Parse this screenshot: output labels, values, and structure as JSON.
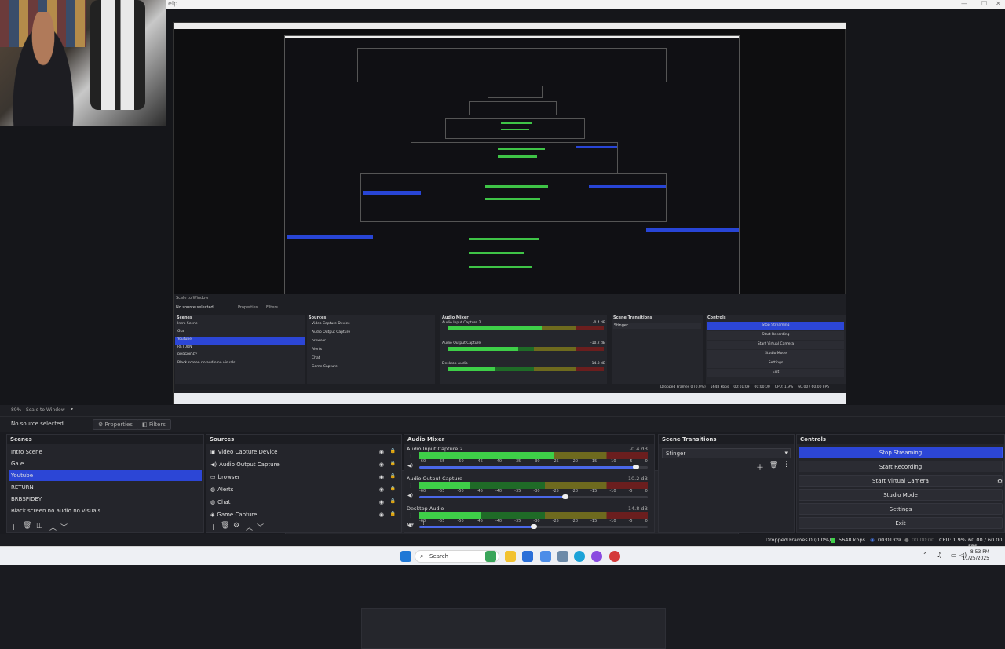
{
  "window": {
    "title_fragment": "elp"
  },
  "preview": {
    "inner_obs": {
      "scale_label": "Scale to Window",
      "no_source": "No source selected",
      "properties": "Properties",
      "filters": "Filters",
      "scenes_header": "Scenes",
      "sources_header": "Sources",
      "mixer_header": "Audio Mixer",
      "transitions_header": "Scene Transitions",
      "controls_header": "Controls",
      "scenes": [
        "Intro Scene",
        "Gta",
        "Youtube",
        "RETURN",
        "BRBSPIDEY",
        "Black screen no audio no visuals"
      ],
      "sources": [
        "Video Capture Device",
        "Audio Output Capture",
        "browser",
        "Alerts",
        "Chat",
        "Game Capture"
      ],
      "mixer": [
        {
          "name": "Audio Input Capture 2",
          "db": "-0.4 dB"
        },
        {
          "name": "Audio Output Capture",
          "db": "-10.2 dB"
        },
        {
          "name": "Desktop Audio",
          "db": "-14.8 dB"
        }
      ],
      "transition": "Stinger",
      "controls": [
        "Stop Streaming",
        "Start Recording",
        "Start Virtual Camera",
        "Studio Mode",
        "Settings",
        "Exit"
      ],
      "status": [
        "Dropped Frames 0 (0.0%)",
        "5648 kbps",
        "00:01:09",
        "00:00:00",
        "CPU: 1.9%",
        "60.00 / 60.00 FPS"
      ]
    }
  },
  "scene_bar": {
    "zoom": "89%",
    "scale_mode": "Scale to Window"
  },
  "props_bar": {
    "no_source": "No source selected",
    "properties": "Properties",
    "filters": "Filters"
  },
  "scenes": {
    "header": "Scenes",
    "items": [
      "Intro Scene",
      "Ga.e",
      "Youtube",
      "RETURN",
      "BRBSPIDEY",
      "Black screen no audio no visuals"
    ],
    "selected_index": 2
  },
  "sources": {
    "header": "Sources",
    "items": [
      "Video Capture Device",
      "Audio Output Capture",
      "browser",
      "Alerts",
      "Chat",
      "Game Capture"
    ],
    "icons": [
      "camera-icon",
      "speaker-icon",
      "browser-icon",
      "globe-icon",
      "globe-icon",
      "gamepad-icon"
    ]
  },
  "mixer": {
    "header": "Audio Mixer",
    "ticks": [
      "-60",
      "-55",
      "-50",
      "-45",
      "-40",
      "-35",
      "-30",
      "-25",
      "-20",
      "-15",
      "-10",
      "-5",
      "0"
    ],
    "channels": [
      {
        "name": "Audio Input Capture 2",
        "db": "-0.4 dB",
        "level": 0.59,
        "volume": 0.95
      },
      {
        "name": "Audio Output Capture",
        "db": "-10.2 dB",
        "level": 0.22,
        "volume": 0.64
      },
      {
        "name": "Desktop Audio",
        "db": "-14.8 dB",
        "level": 0.27,
        "volume": 0.5
      }
    ]
  },
  "transitions": {
    "header": "Scene Transitions",
    "selected": "Stinger"
  },
  "controls": {
    "header": "Controls",
    "buttons": [
      "Stop Streaming",
      "Start Recording",
      "Start Virtual Camera",
      "Studio Mode",
      "Settings",
      "Exit"
    ],
    "active_index": 0
  },
  "status": {
    "dropped": "Dropped Frames 0 (0.0%)",
    "bitrate": "5648 kbps",
    "stream_time": "00:01:09",
    "rec_time": "00:00:00",
    "cpu": "CPU: 1.9%",
    "fps": "60.00 / 60.00 FPS"
  },
  "taskbar": {
    "search_placeholder": "Search",
    "time": "8:53 PM",
    "date": "11/25/2025"
  },
  "colors": {
    "accent": "#2c46d6",
    "meter_green": "#3ecf48",
    "meter_yellow": "#c6b52a",
    "meter_red": "#c23232"
  }
}
